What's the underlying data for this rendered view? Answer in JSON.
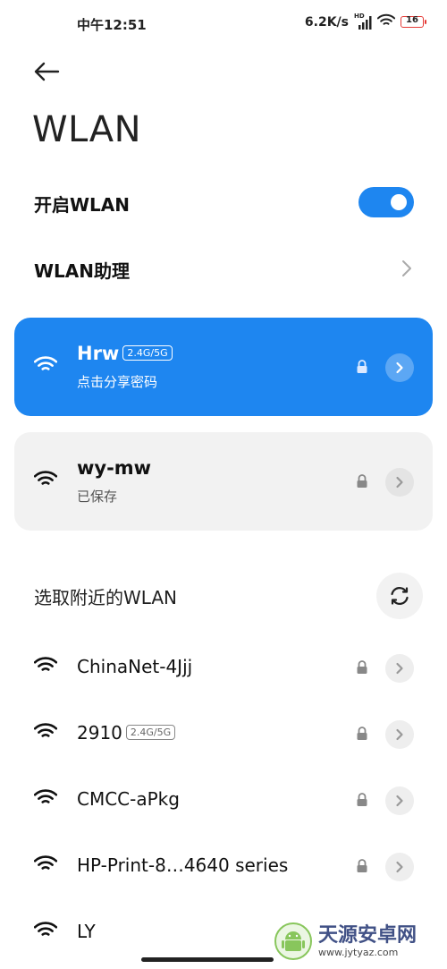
{
  "status_bar": {
    "time": "中午12:51",
    "net_speed": "6.2K/s",
    "network_type": "HD",
    "battery": "16",
    "icons": [
      "signal-icon",
      "wifi-icon",
      "battery-icon"
    ],
    "battery_color": "#e53935"
  },
  "header": {
    "back_icon": "arrow-left-icon",
    "title": "WLAN"
  },
  "settings": {
    "wlan_toggle_label": "开启WLAN",
    "wlan_toggle_on": true,
    "assistant_label": "WLAN助理"
  },
  "connected": {
    "ssid": "Hrw",
    "band": "2.4G/5G",
    "subtitle": "点击分享密码"
  },
  "saved": {
    "ssid": "wy-mw",
    "subtitle": "已保存"
  },
  "nearby": {
    "label": "选取附近的WLAN",
    "refresh_icon": "refresh-icon",
    "networks": [
      {
        "ssid": "ChinaNet-4Jjj",
        "band": "",
        "locked": true
      },
      {
        "ssid": "2910",
        "band": "2.4G/5G",
        "locked": true
      },
      {
        "ssid": "CMCC-aPkg",
        "band": "",
        "locked": true
      },
      {
        "ssid": "HP-Print-8…4640 series",
        "band": "",
        "locked": true
      },
      {
        "ssid": "LY",
        "band": "",
        "locked": false
      }
    ]
  },
  "watermark": {
    "name": "天源安卓网",
    "url": "www.jytyaz.com"
  },
  "colors": {
    "accent": "#1e86f0",
    "card_gray": "#f2f2f2",
    "text": "#111111"
  }
}
